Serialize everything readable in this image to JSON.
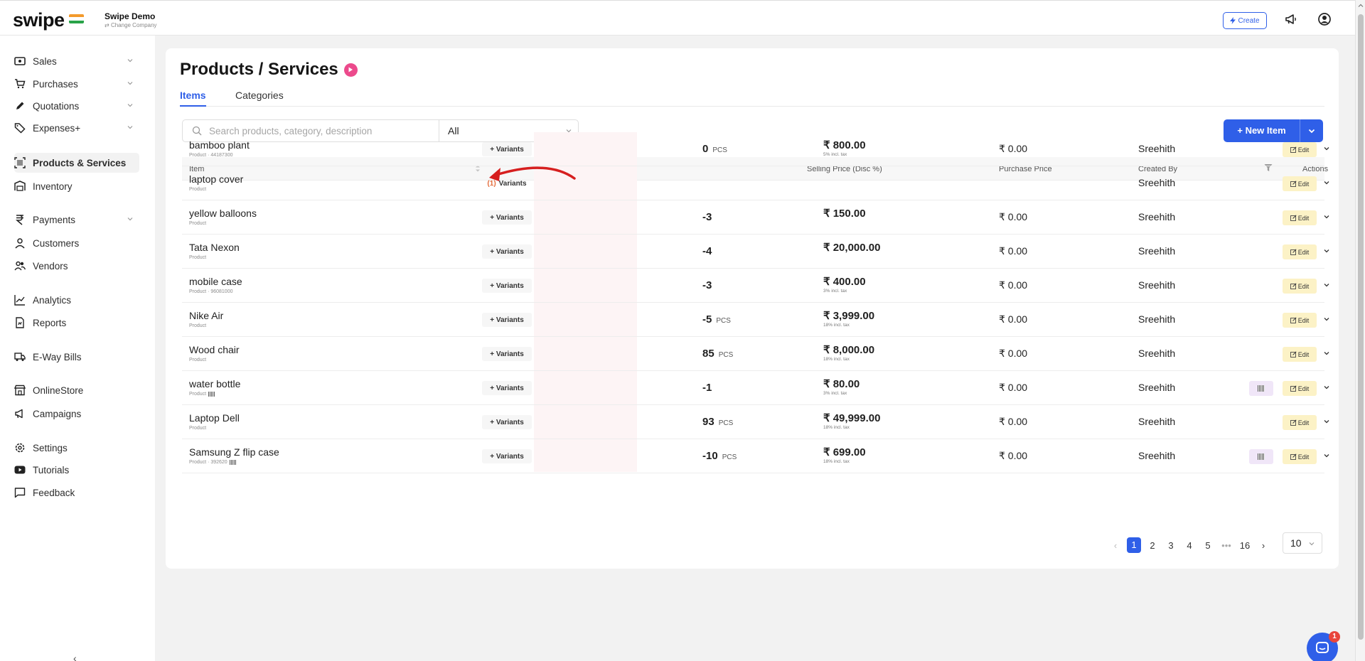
{
  "topbar": {
    "logo": "swipe",
    "company_name": "Swipe Demo",
    "company_sub": "Change Company",
    "create_label": "Create",
    "icons": [
      "flag-india-icon",
      "lightning-icon",
      "megaphone-icon",
      "user-circle-icon"
    ]
  },
  "sidebar": {
    "items": [
      {
        "label": "Sales",
        "icon": "banknote-icon",
        "has_chevron": true
      },
      {
        "label": "Purchases",
        "icon": "cart-icon",
        "has_chevron": true
      },
      {
        "label": "Quotations",
        "icon": "pen-icon",
        "has_chevron": true
      },
      {
        "label": "Expenses+",
        "icon": "tag-icon",
        "has_chevron": true
      },
      {
        "label": "Products & Services",
        "icon": "barcode-box-icon",
        "has_chevron": false,
        "active": true
      },
      {
        "label": "Inventory",
        "icon": "warehouse-icon",
        "has_chevron": false
      },
      {
        "label": "Payments",
        "icon": "rupee-icon",
        "has_chevron": true
      },
      {
        "label": "Customers",
        "icon": "user-icon",
        "has_chevron": false
      },
      {
        "label": "Vendors",
        "icon": "users-icon",
        "has_chevron": false
      },
      {
        "label": "Analytics",
        "icon": "chart-line-icon",
        "has_chevron": false
      },
      {
        "label": "Reports",
        "icon": "report-icon",
        "has_chevron": false
      },
      {
        "label": "E-Way Bills",
        "icon": "truck-icon",
        "has_chevron": false
      },
      {
        "label": "OnlineStore",
        "icon": "store-icon",
        "has_chevron": false
      },
      {
        "label": "Campaigns",
        "icon": "megaphone-icon",
        "has_chevron": false
      },
      {
        "label": "Settings",
        "icon": "gear-icon",
        "has_chevron": false
      },
      {
        "label": "Tutorials",
        "icon": "youtube-icon",
        "has_chevron": false
      },
      {
        "label": "Feedback",
        "icon": "message-icon",
        "has_chevron": false
      }
    ],
    "collapse_label": "‹"
  },
  "page": {
    "title": "Products / Services",
    "tabs": [
      {
        "label": "Items",
        "active": true
      },
      {
        "label": "Categories",
        "active": false
      }
    ],
    "search_placeholder": "Search products, category, description",
    "filter_value": "All",
    "new_item_label": "+ New Item"
  },
  "table": {
    "headers": {
      "item": "Item",
      "selling_price": "Selling Price (Disc %)",
      "purchase_price": "Purchase Price",
      "created_by": "Created By",
      "actions": "Actions"
    },
    "rows": [
      {
        "name": "bamboo plant",
        "sub": "Product · 44187300",
        "barcode": false,
        "variants": "+ Variants",
        "variant_count": "",
        "stock": "0",
        "unit": "PCS",
        "selling": "₹ 800.00",
        "selling_note": "5% incl. tax",
        "purchase": "₹ 0.00",
        "created_by": "Sreehith",
        "has_barcode_btn": false
      },
      {
        "name": "laptop cover",
        "sub": "Product",
        "barcode": false,
        "variants": "Variants",
        "variant_count": "(1)",
        "stock": "",
        "unit": "",
        "selling": "",
        "selling_note": "",
        "purchase": "",
        "created_by": "Sreehith",
        "has_barcode_btn": false
      },
      {
        "name": "yellow balloons",
        "sub": "Product",
        "barcode": false,
        "variants": "+ Variants",
        "variant_count": "",
        "stock": "-3",
        "unit": "",
        "selling": "₹ 150.00",
        "selling_note": "",
        "purchase": "₹ 0.00",
        "created_by": "Sreehith",
        "has_barcode_btn": false
      },
      {
        "name": "Tata Nexon",
        "sub": "Product",
        "barcode": false,
        "variants": "+ Variants",
        "variant_count": "",
        "stock": "-4",
        "unit": "",
        "selling": "₹ 20,000.00",
        "selling_note": "",
        "purchase": "₹ 0.00",
        "created_by": "Sreehith",
        "has_barcode_btn": false
      },
      {
        "name": "mobile case",
        "sub": "Product · 96081000",
        "barcode": false,
        "variants": "+ Variants",
        "variant_count": "",
        "stock": "-3",
        "unit": "",
        "selling": "₹ 400.00",
        "selling_note": "3% incl. tax",
        "purchase": "₹ 0.00",
        "created_by": "Sreehith",
        "has_barcode_btn": false
      },
      {
        "name": "Nike Air",
        "sub": "Product",
        "barcode": false,
        "variants": "+ Variants",
        "variant_count": "",
        "stock": "-5",
        "unit": "PCS",
        "selling": "₹ 3,999.00",
        "selling_note": "18% incl. tax",
        "purchase": "₹ 0.00",
        "created_by": "Sreehith",
        "has_barcode_btn": false
      },
      {
        "name": "Wood chair",
        "sub": "Product",
        "barcode": false,
        "variants": "+ Variants",
        "variant_count": "",
        "stock": "85",
        "unit": "PCS",
        "selling": "₹ 8,000.00",
        "selling_note": "18% incl. tax",
        "purchase": "₹ 0.00",
        "created_by": "Sreehith",
        "has_barcode_btn": false
      },
      {
        "name": "water bottle",
        "sub": "Product",
        "barcode": true,
        "variants": "+ Variants",
        "variant_count": "",
        "stock": "-1",
        "unit": "",
        "selling": "₹ 80.00",
        "selling_note": "3% incl. tax",
        "purchase": "₹ 0.00",
        "created_by": "Sreehith",
        "has_barcode_btn": true
      },
      {
        "name": "Laptop Dell",
        "sub": "Product",
        "barcode": false,
        "variants": "+ Variants",
        "variant_count": "",
        "stock": "93",
        "unit": "PCS",
        "selling": "₹ 49,999.00",
        "selling_note": "18% incl. tax",
        "purchase": "₹ 0.00",
        "created_by": "Sreehith",
        "has_barcode_btn": false
      },
      {
        "name": "Samsung Z flip case",
        "sub": "Product · 392620",
        "barcode": true,
        "variants": "+ Variants",
        "variant_count": "",
        "stock": "-10",
        "unit": "PCS",
        "selling": "₹ 699.00",
        "selling_note": "18% incl. tax",
        "purchase": "₹ 0.00",
        "created_by": "Sreehith",
        "has_barcode_btn": true
      }
    ],
    "edit_label": "Edit"
  },
  "pagination": {
    "pages": [
      "1",
      "2",
      "3",
      "4",
      "5",
      "•••",
      "16"
    ],
    "current": "1",
    "page_size": "10"
  },
  "chat_badge": "1",
  "colors": {
    "accent": "#2f5fe8",
    "edit_bg": "#fcf2c6",
    "stock_bg": "#fdf4f5",
    "play": "#ec4a8c"
  }
}
